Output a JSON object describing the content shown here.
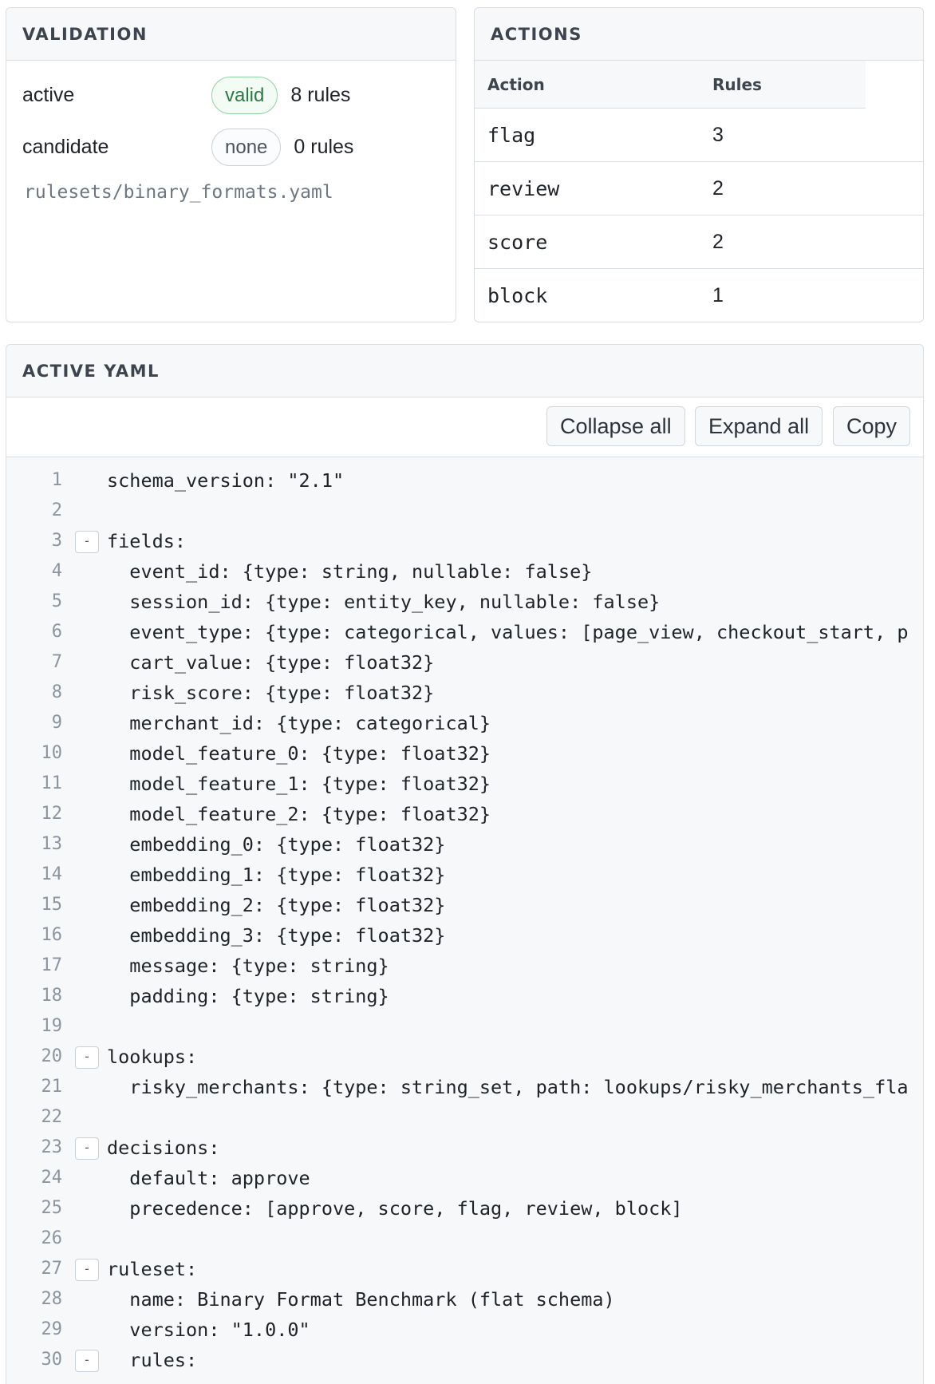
{
  "validation": {
    "title": "VALIDATION",
    "rows": [
      {
        "label": "active",
        "status": "valid",
        "count": "8 rules"
      },
      {
        "label": "candidate",
        "status": "none",
        "count": "0 rules"
      }
    ],
    "path": "rulesets/binary_formats.yaml",
    "colors": {
      "valid": "#2b7a45",
      "none": "#4b535c"
    }
  },
  "actions": {
    "title": "ACTIONS",
    "columns": {
      "action": "Action",
      "rules": "Rules"
    },
    "rows": [
      {
        "action": "flag",
        "rules": "3"
      },
      {
        "action": "review",
        "rules": "2"
      },
      {
        "action": "score",
        "rules": "2"
      },
      {
        "action": "block",
        "rules": "1"
      }
    ]
  },
  "yaml": {
    "title": "ACTIVE YAML",
    "buttons": {
      "collapse": "Collapse all",
      "expand": "Expand all",
      "copy": "Copy"
    },
    "fold_glyph": "-",
    "lines": [
      {
        "n": "1",
        "text": "schema_version: \"2.1\"",
        "fold": false
      },
      {
        "n": "2",
        "text": "",
        "fold": false
      },
      {
        "n": "3",
        "text": "fields:",
        "fold": true
      },
      {
        "n": "4",
        "text": "  event_id: {type: string, nullable: false}",
        "fold": false
      },
      {
        "n": "5",
        "text": "  session_id: {type: entity_key, nullable: false}",
        "fold": false
      },
      {
        "n": "6",
        "text": "  event_type: {type: categorical, values: [page_view, checkout_start, p",
        "fold": false
      },
      {
        "n": "7",
        "text": "  cart_value: {type: float32}",
        "fold": false
      },
      {
        "n": "8",
        "text": "  risk_score: {type: float32}",
        "fold": false
      },
      {
        "n": "9",
        "text": "  merchant_id: {type: categorical}",
        "fold": false
      },
      {
        "n": "10",
        "text": "  model_feature_0: {type: float32}",
        "fold": false
      },
      {
        "n": "11",
        "text": "  model_feature_1: {type: float32}",
        "fold": false
      },
      {
        "n": "12",
        "text": "  model_feature_2: {type: float32}",
        "fold": false
      },
      {
        "n": "13",
        "text": "  embedding_0: {type: float32}",
        "fold": false
      },
      {
        "n": "14",
        "text": "  embedding_1: {type: float32}",
        "fold": false
      },
      {
        "n": "15",
        "text": "  embedding_2: {type: float32}",
        "fold": false
      },
      {
        "n": "16",
        "text": "  embedding_3: {type: float32}",
        "fold": false
      },
      {
        "n": "17",
        "text": "  message: {type: string}",
        "fold": false
      },
      {
        "n": "18",
        "text": "  padding: {type: string}",
        "fold": false
      },
      {
        "n": "19",
        "text": "",
        "fold": false
      },
      {
        "n": "20",
        "text": "lookups:",
        "fold": true
      },
      {
        "n": "21",
        "text": "  risky_merchants: {type: string_set, path: lookups/risky_merchants_fla",
        "fold": false
      },
      {
        "n": "22",
        "text": "",
        "fold": false
      },
      {
        "n": "23",
        "text": "decisions:",
        "fold": true
      },
      {
        "n": "24",
        "text": "  default: approve",
        "fold": false
      },
      {
        "n": "25",
        "text": "  precedence: [approve, score, flag, review, block]",
        "fold": false
      },
      {
        "n": "26",
        "text": "",
        "fold": false
      },
      {
        "n": "27",
        "text": "ruleset:",
        "fold": true
      },
      {
        "n": "28",
        "text": "  name: Binary Format Benchmark (flat schema)",
        "fold": false
      },
      {
        "n": "29",
        "text": "  version: \"1.0.0\"",
        "fold": false
      },
      {
        "n": "30",
        "text": "  rules:",
        "fold": true
      }
    ]
  }
}
